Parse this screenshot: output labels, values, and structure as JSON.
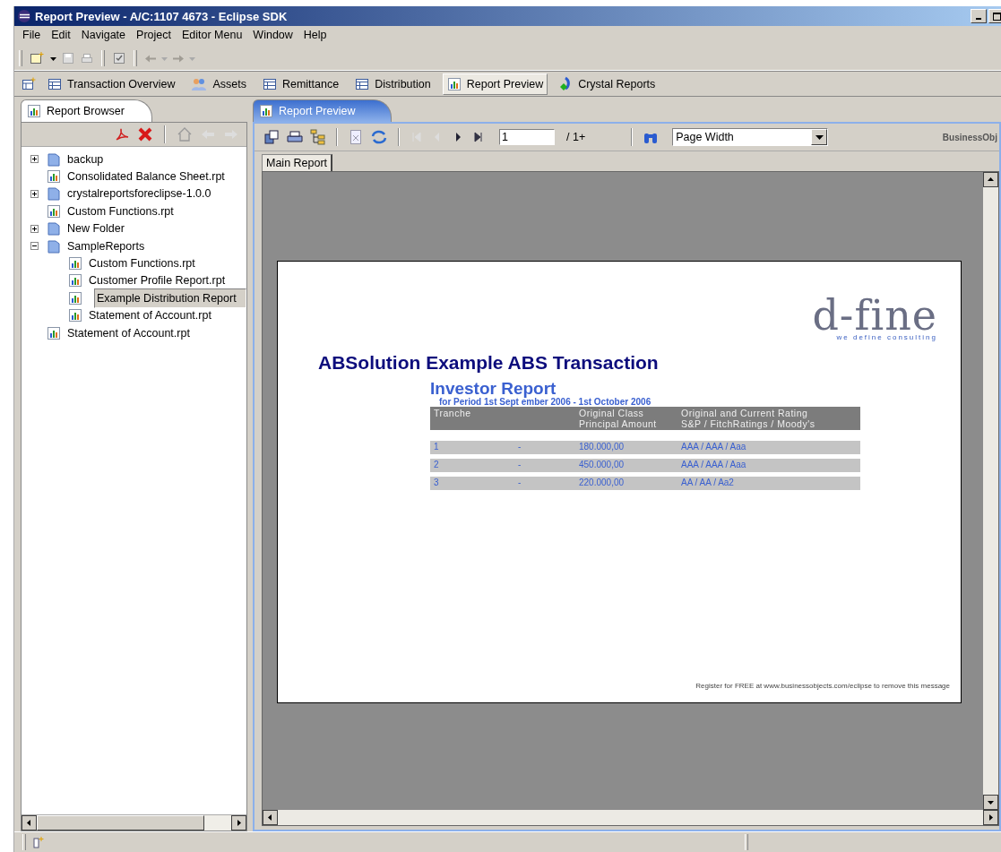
{
  "window": {
    "title": "Report Preview - A/C:1107 4673 - Eclipse SDK"
  },
  "menu": [
    "File",
    "Edit",
    "Navigate",
    "Project",
    "Editor Menu",
    "Window",
    "Help"
  ],
  "perspectives": [
    {
      "label": "Transaction Overview",
      "kind": "table",
      "selected": false
    },
    {
      "label": "Assets",
      "kind": "people",
      "selected": false
    },
    {
      "label": "Remittance",
      "kind": "table",
      "selected": false
    },
    {
      "label": "Distribution",
      "kind": "table",
      "selected": false
    },
    {
      "label": "Report Preview",
      "kind": "report",
      "selected": true
    },
    {
      "label": "Crystal Reports",
      "kind": "crystal",
      "selected": false
    }
  ],
  "report_browser": {
    "tab": "Report Browser",
    "tree": [
      {
        "label": "backup",
        "kind": "folder",
        "expanded": false,
        "selected": false
      },
      {
        "label": "Consolidated Balance Sheet.rpt",
        "kind": "report",
        "selected": false
      },
      {
        "label": "crystalreportsforeclipse-1.0.0",
        "kind": "folder",
        "expanded": false,
        "selected": false
      },
      {
        "label": "Custom Functions.rpt",
        "kind": "report",
        "selected": false
      },
      {
        "label": "New Folder",
        "kind": "folder",
        "expanded": false,
        "selected": false
      },
      {
        "label": "SampleReports",
        "kind": "folder",
        "expanded": true,
        "selected": false,
        "children": [
          {
            "label": "Custom Functions.rpt",
            "kind": "report",
            "selected": false
          },
          {
            "label": "Customer Profile Report.rpt",
            "kind": "report",
            "selected": false
          },
          {
            "label": "Example Distribution Report",
            "kind": "report",
            "selected": true
          },
          {
            "label": "Statement of Account.rpt",
            "kind": "report",
            "selected": false
          }
        ]
      },
      {
        "label": "Statement of Account.rpt",
        "kind": "report",
        "selected": false
      }
    ]
  },
  "editor": {
    "tab": "Report Preview",
    "page_field": "1",
    "page_count": "/ 1+",
    "zoom_select": "Page Width",
    "brand": "BusinessObj",
    "report_tab": "Main Report",
    "report": {
      "logo": "d-fine",
      "logo_tagline": "we define consulting",
      "title": "ABSolution Example ABS Transaction",
      "subtitle": "Investor Report",
      "period": "for Period 1st Sept ember 2006 - 1st October 2006",
      "columns": [
        "Tranche",
        "",
        "Original Class\nPrincipal Amount",
        "Original and Current Rating\nS&P / FitchRatings / Moody's"
      ],
      "rows": [
        [
          "1",
          "-",
          "180.000,00",
          "AAA / AAA / Aaa"
        ],
        [
          "2",
          "-",
          "450.000,00",
          "AAA / AAA / Aaa"
        ],
        [
          "3",
          "-",
          "220.000,00",
          "AA  / AA / Aa2"
        ]
      ],
      "footer": "Register for FREE at www.businessobjects.com/eclipse to remove this message"
    }
  }
}
